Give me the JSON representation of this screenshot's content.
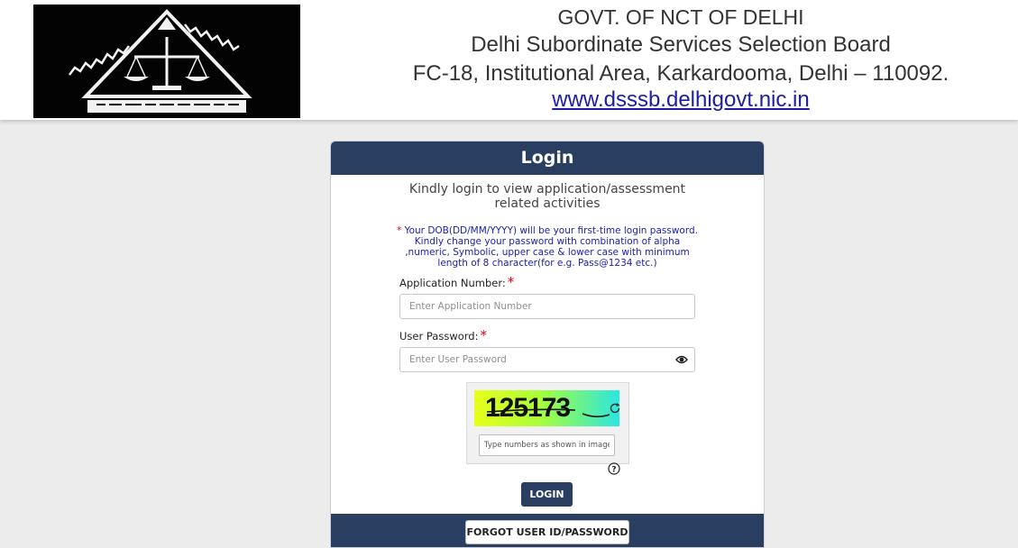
{
  "header": {
    "line1": "GOVT. OF NCT OF DELHI",
    "line2": "Delhi Subordinate Services Selection Board",
    "line3": "FC-18, Institutional Area, Karkardooma, Delhi – 110092.",
    "website": "www.dsssb.delhigovt.nic.in",
    "logo_text": "दिल्ली अधीनस्थ सेवा चयन बोर्ड"
  },
  "login": {
    "title": "Login",
    "intro": "Kindly login to view application/assessment related activities",
    "notice_star": "*",
    "notice": " Your DOB(DD/MM/YYYY) will be your first-time login password. Kindly change your password with combination of alpha ,numeric, Symbolic, upper case & lower case with minimum length of 8 character(for e.g. Pass@1234 etc.)",
    "application_label": "Application Number:",
    "application_placeholder": "Enter Application Number",
    "application_value": "",
    "password_label": "User Password:",
    "password_placeholder": "Enter User Password",
    "password_value": "",
    "required_mark": "*",
    "captcha_text": "125173",
    "captcha_placeholder": "Type numbers as shown in image",
    "captcha_value": "",
    "login_button": "LOGIN",
    "forgot_button": "FORGOT USER ID/PASSWORD"
  },
  "icons": {
    "show_password": "eye-icon",
    "refresh_captcha": "refresh-icon",
    "captcha_help": "help-icon",
    "logo": "scales-of-justice-logo"
  },
  "colors": {
    "primary": "#2a3e62",
    "link": "#1c1ca6",
    "notice": "#1c22b0",
    "required": "#d8000c",
    "page_bg": "#ececec"
  }
}
